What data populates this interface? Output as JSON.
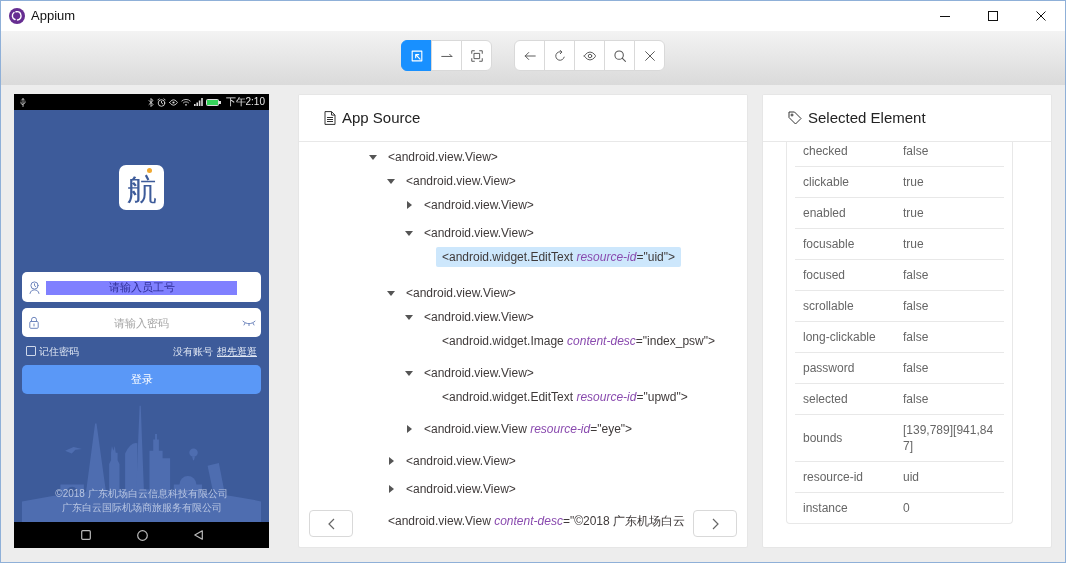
{
  "window": {
    "title": "Appium"
  },
  "toolbar": {
    "mode_buttons": [
      {
        "selected": true
      },
      {
        "selected": false
      },
      {
        "selected": false
      }
    ]
  },
  "device_screen": {
    "status_bar": {
      "time": "下午2:10"
    },
    "logo": {
      "text": "航"
    },
    "username_field": {
      "placeholder": "请输入员工号",
      "highlighted": true
    },
    "password_field": {
      "placeholder": "请输入密码"
    },
    "remember_password": {
      "label": "记住密码",
      "checked": false
    },
    "signup_text": "没有账号",
    "guest_link": "想先逛逛",
    "login_button": "登录",
    "footer": [
      "©2018 广东机场白云信息科技有限公司",
      "广东白云国际机场商旅服务有限公司"
    ]
  },
  "app_source": {
    "title": "App Source",
    "tree": [
      {
        "label": "<android.view.View>",
        "expanded": true,
        "selected": false,
        "children": [
          {
            "label": "<android.view.View>",
            "expanded": true,
            "selected": false,
            "children": [
              {
                "label": "<android.view.View>",
                "expanded": false,
                "selected": false
              },
              {
                "label": "<android.view.View>",
                "expanded": true,
                "selected": false,
                "children": [
                  {
                    "label": "<android.widget.EditText *resource-id*=\"uid\">",
                    "selected": true
                  }
                ]
              }
            ]
          },
          {
            "label": "<android.view.View>",
            "expanded": true,
            "selected": false,
            "children": [
              {
                "label": "<android.view.View>",
                "expanded": true,
                "selected": false,
                "children": [
                  {
                    "label": "<android.widget.Image *content-desc*=\"index_psw\">",
                    "selected": false
                  }
                ]
              },
              {
                "label": "<android.view.View>",
                "expanded": true,
                "selected": false,
                "children": [
                  {
                    "label": "<android.widget.EditText *resource-id*=\"upwd\">",
                    "selected": false
                  }
                ]
              },
              {
                "label": "<android.view.View *resource-id*=\"eye\">",
                "expanded": false,
                "selected": false
              }
            ]
          },
          {
            "label": "<android.view.View>",
            "expanded": false,
            "selected": false
          },
          {
            "label": "<android.view.View>",
            "expanded": false,
            "selected": false
          }
        ]
      },
      {
        "label": "<android.view.View *content-desc*=\"©2018 广东机场白云",
        "selected": false
      }
    ]
  },
  "selected_element": {
    "title": "Selected Element",
    "attributes": [
      {
        "name": "checked",
        "value": "false"
      },
      {
        "name": "clickable",
        "value": "true"
      },
      {
        "name": "enabled",
        "value": "true"
      },
      {
        "name": "focusable",
        "value": "true"
      },
      {
        "name": "focused",
        "value": "false"
      },
      {
        "name": "scrollable",
        "value": "false"
      },
      {
        "name": "long-clickable",
        "value": "false"
      },
      {
        "name": "password",
        "value": "false"
      },
      {
        "name": "selected",
        "value": "false"
      },
      {
        "name": "bounds",
        "value": "[139,789][941,847]"
      },
      {
        "name": "resource-id",
        "value": "uid"
      },
      {
        "name": "instance",
        "value": "0"
      }
    ]
  }
}
